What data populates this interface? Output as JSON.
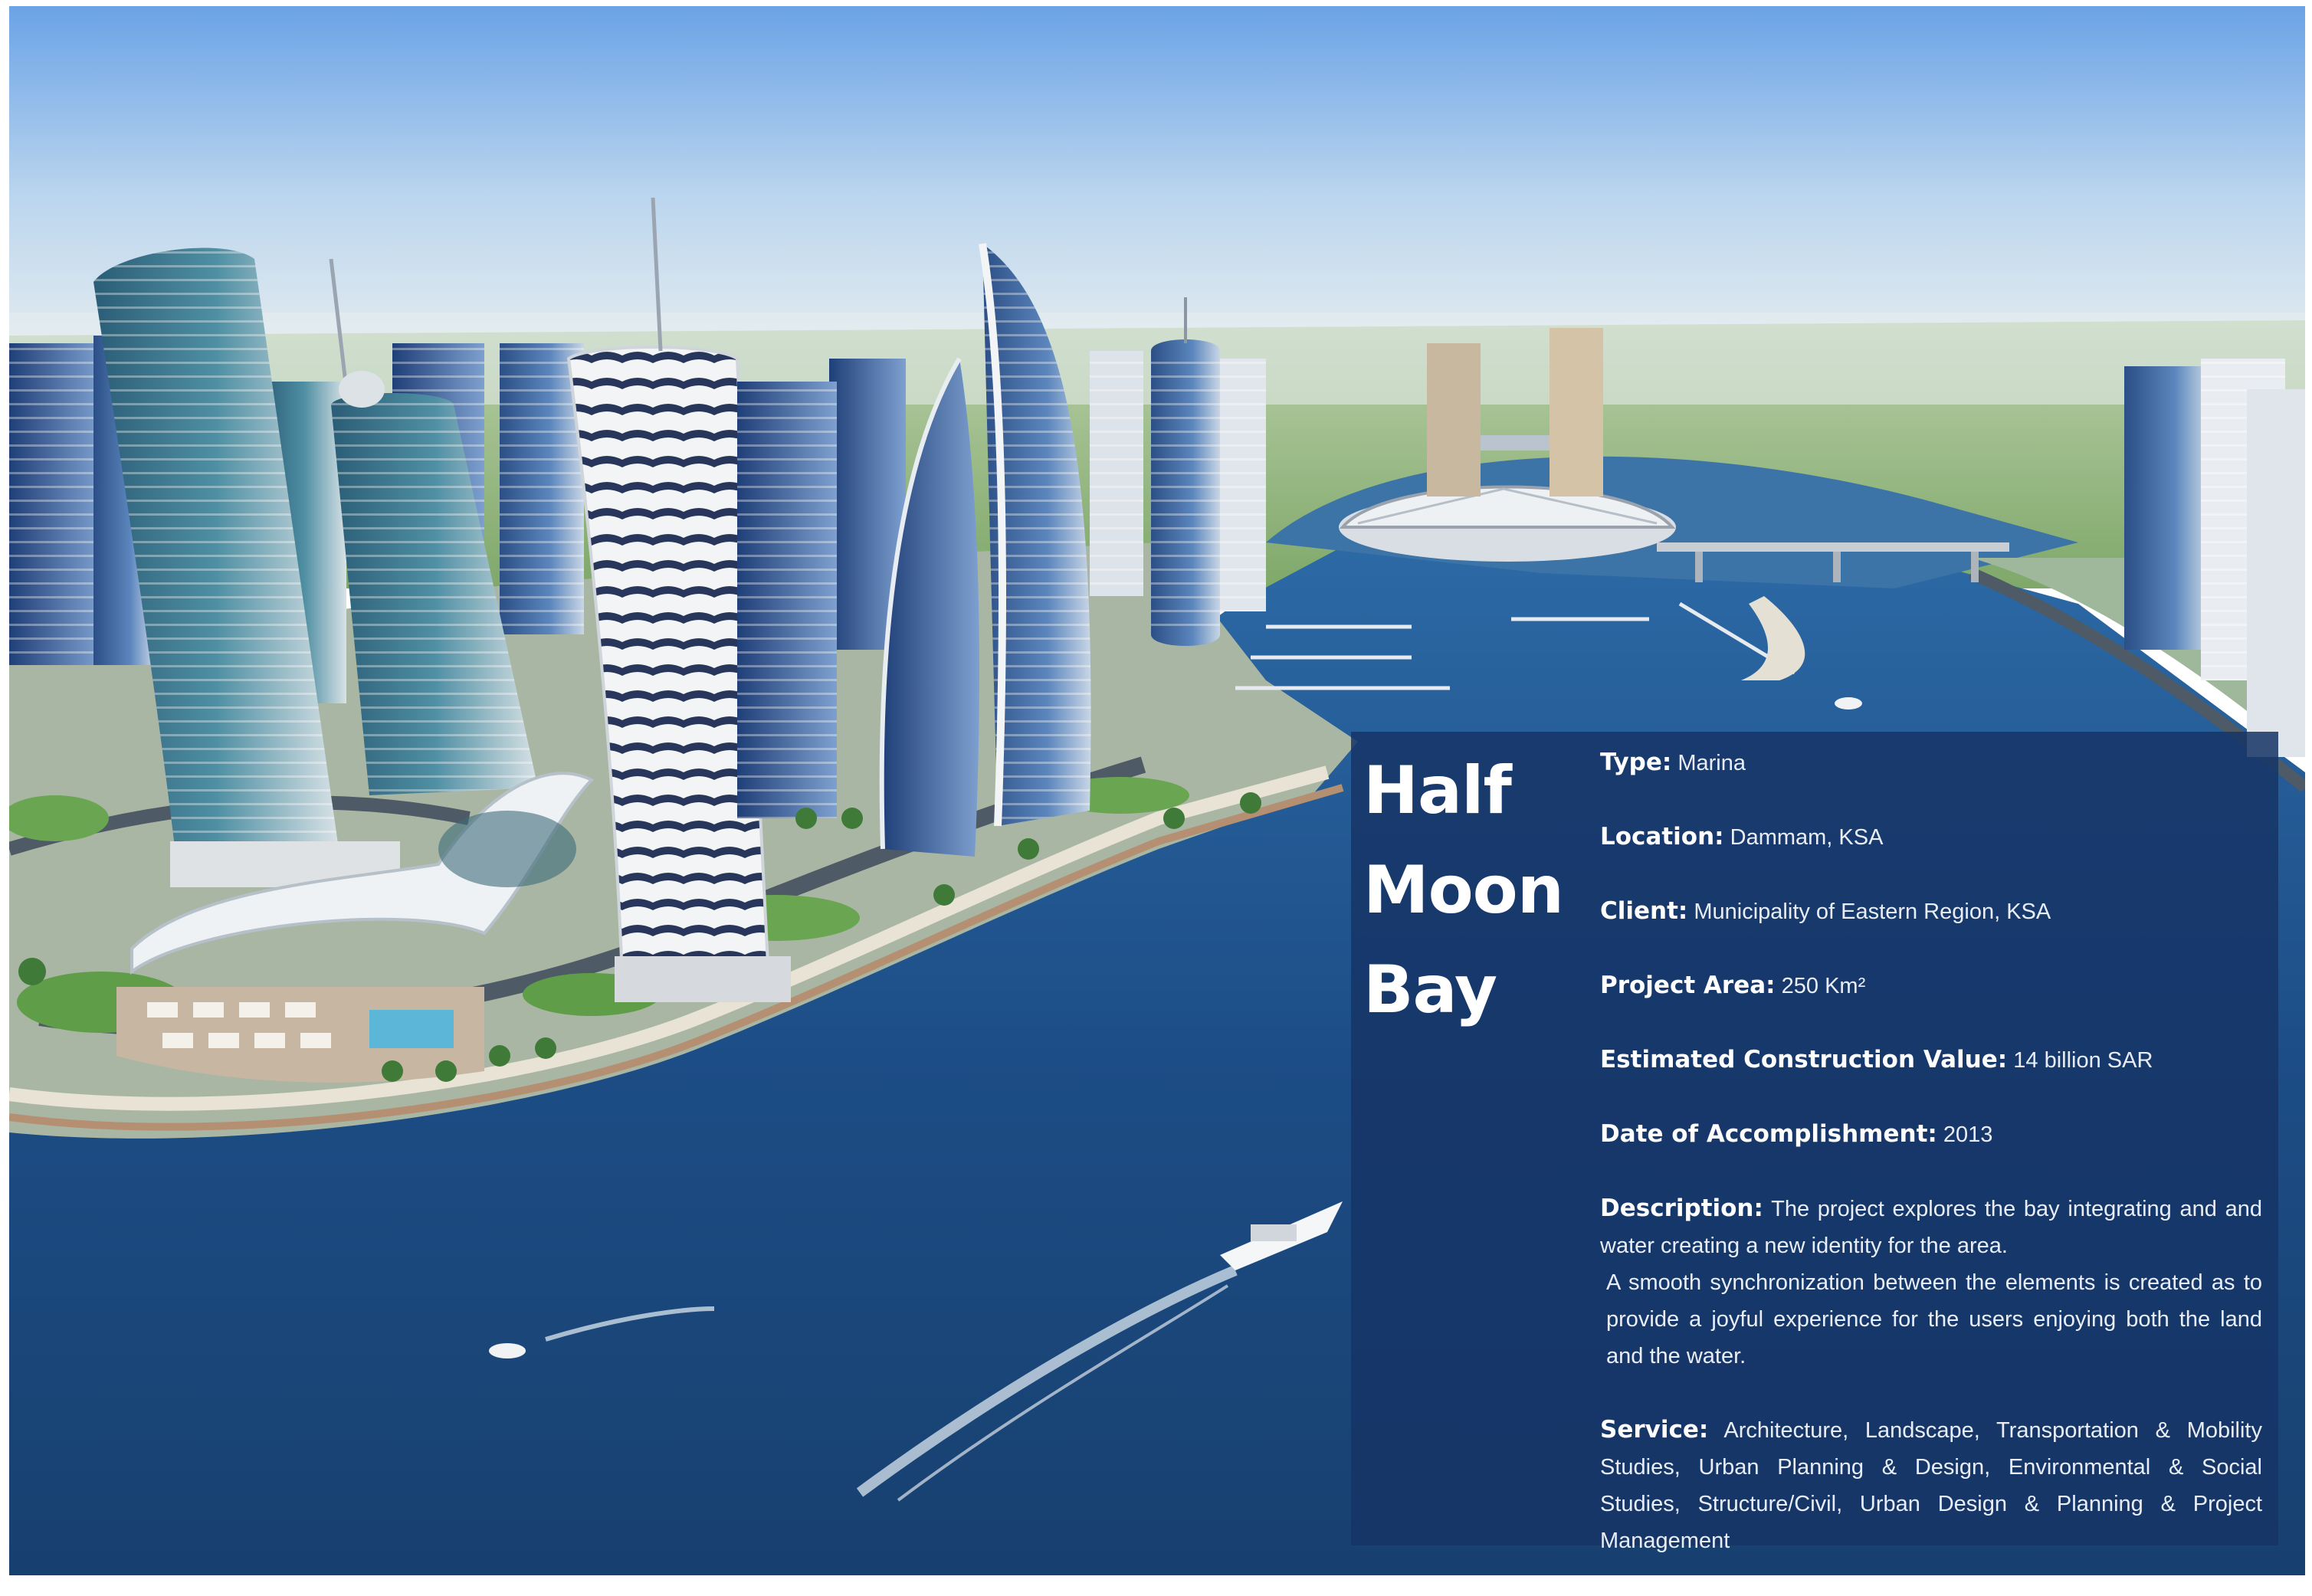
{
  "project": {
    "title_lines": [
      "Half",
      "Moon",
      "Bay"
    ],
    "fields": {
      "type": {
        "label": "Type:",
        "value": "Marina"
      },
      "location": {
        "label": "Location:",
        "value": "Dammam, KSA"
      },
      "client": {
        "label": "Client:",
        "value": "Municipality of Eastern Region, KSA"
      },
      "area": {
        "label": "Project Area:",
        "value": "250 Km²"
      },
      "value": {
        "label": "Estimated Construction Value:",
        "value": "14 billion SAR"
      },
      "date": {
        "label": "Date of Accomplishment:",
        "value": "2013"
      },
      "description": {
        "label": "Description:",
        "value": "The project explores the bay integrating and and water creating a new identity for the area.",
        "value2": "A smooth synchronization between the elements is created as to provide a joyful experience for the users enjoying both the land and the water."
      },
      "service": {
        "label": "Service:",
        "value": "Architecture, Landscape, Transportation & Mobility Studies, Urban Planning & Design, Environmental & Social Studies, Structure/Civil, Urban Design & Planning & Project Management"
      }
    }
  },
  "colors": {
    "panel": "#163466",
    "sea": "#1d4d86",
    "sky": "#7fb0e6"
  }
}
